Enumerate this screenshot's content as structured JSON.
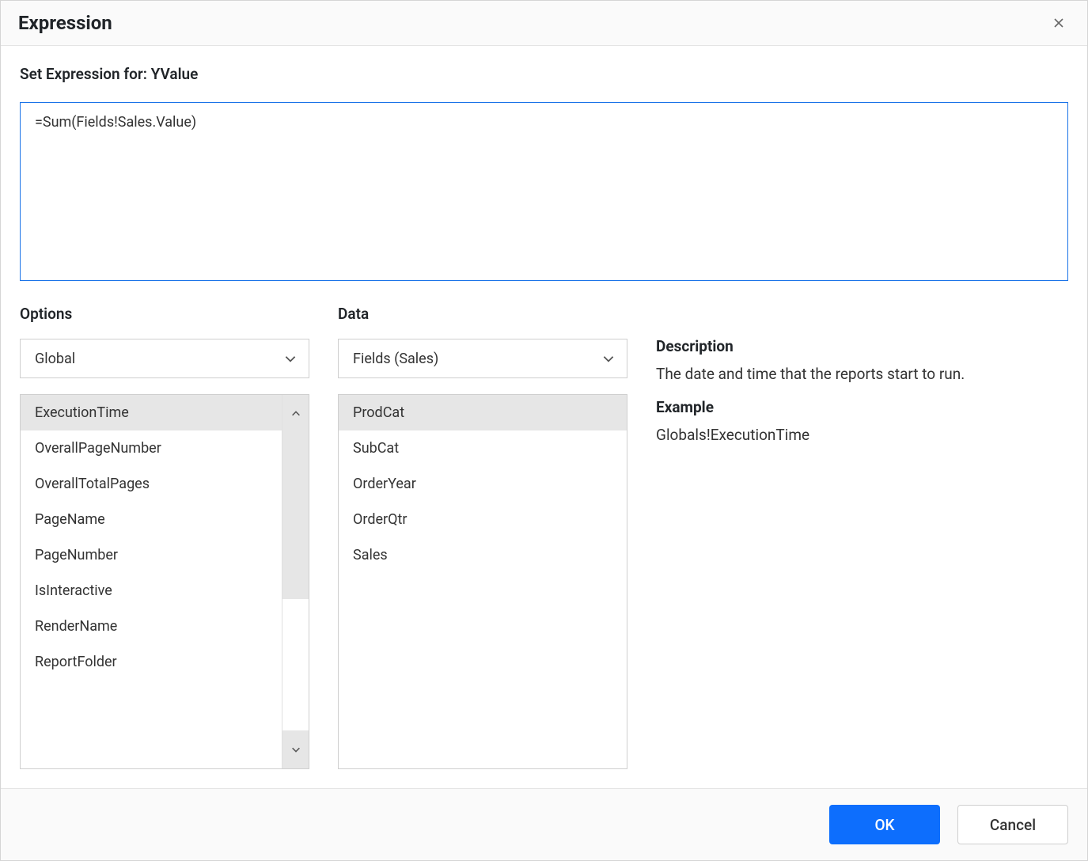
{
  "dialog": {
    "title": "Expression",
    "set_expression_label": "Set Expression for: YValue",
    "expression_value": "=Sum(Fields!Sales.Value)"
  },
  "options": {
    "heading": "Options",
    "selected": "Global",
    "items": [
      {
        "label": "ExecutionTime",
        "selected": true
      },
      {
        "label": "OverallPageNumber",
        "selected": false
      },
      {
        "label": "OverallTotalPages",
        "selected": false
      },
      {
        "label": "PageName",
        "selected": false
      },
      {
        "label": "PageNumber",
        "selected": false
      },
      {
        "label": "IsInteractive",
        "selected": false
      },
      {
        "label": "RenderName",
        "selected": false
      },
      {
        "label": "ReportFolder",
        "selected": false
      }
    ]
  },
  "data_panel": {
    "heading": "Data",
    "selected": "Fields (Sales)",
    "items": [
      {
        "label": "ProdCat",
        "selected": true
      },
      {
        "label": "SubCat",
        "selected": false
      },
      {
        "label": "OrderYear",
        "selected": false
      },
      {
        "label": "OrderQtr",
        "selected": false
      },
      {
        "label": "Sales",
        "selected": false
      }
    ]
  },
  "description": {
    "desc_label": "Description",
    "desc_text": "The date and time that the reports start to run.",
    "example_label": "Example",
    "example_text": "Globals!ExecutionTime"
  },
  "buttons": {
    "ok": "OK",
    "cancel": "Cancel"
  }
}
